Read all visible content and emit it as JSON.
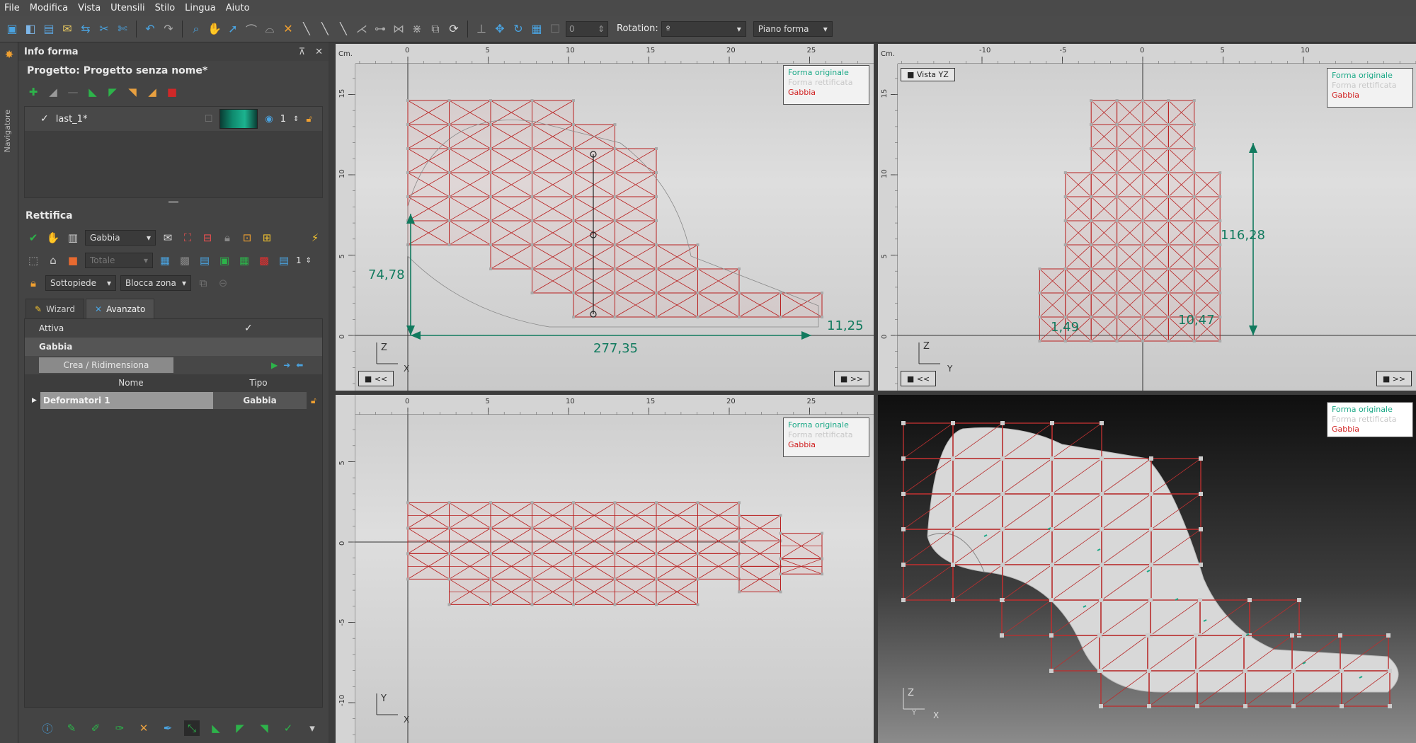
{
  "menu": [
    "File",
    "Modifica",
    "Vista",
    "Utensili",
    "Stilo",
    "Lingua",
    "Aiuto"
  ],
  "toolbar": {
    "spin_value": "0",
    "rotation_label": "Rotation:",
    "rotation_value": "º",
    "plane_value": "Piano forma"
  },
  "sidebar": {
    "navigator_label": "Navigatore",
    "info_title": "Info forma",
    "project_title": "Progetto: Progetto senza nome*",
    "shape": {
      "name": "last_1*",
      "count": "1"
    },
    "rettifica_title": "Rettifica",
    "mode_combo": "Gabbia",
    "total_combo": "Totale",
    "level_value": "1",
    "zone_combo": "Sottopiede",
    "lock_combo": "Blocca zona",
    "tabs": [
      "Wizard",
      "Avanzato"
    ],
    "props": {
      "attiva_label": "Attiva",
      "attiva_check": "✓",
      "group_label": "Gabbia",
      "crea_button": "Crea / Ridimensiona",
      "col_nome": "Nome",
      "col_tipo": "Tipo",
      "row_name": "Deformatori 1",
      "row_type": "Gabbia"
    }
  },
  "viewports": {
    "ruler_unit": "Cm.",
    "legend": {
      "original": "Forma originale",
      "rectified": "Forma rettificata",
      "cage": "Gabbia"
    },
    "side": {
      "xticks": [
        "0",
        "5",
        "10",
        "15",
        "20",
        "25"
      ],
      "yticks": [
        "15",
        "10",
        "5",
        "0"
      ],
      "dim_height": "74,78",
      "dim_length": "277,35",
      "dim_right": "11,25",
      "axis_v": "Z",
      "axis_h": "X",
      "btn_prev": "■ <<",
      "btn_next": "■ >>"
    },
    "front": {
      "label": "■ Vista YZ",
      "xticks": [
        "-10",
        "-5",
        "0",
        "5",
        "10"
      ],
      "yticks": [
        "15",
        "10",
        "5",
        "0"
      ],
      "dim_height": "116,28",
      "dim_left": "1,49",
      "dim_right": "10,47",
      "axis_v": "Z",
      "axis_h": "Y",
      "btn_prev": "■ <<",
      "btn_next": "■ >>"
    },
    "top": {
      "xticks": [
        "0",
        "5",
        "10",
        "15",
        "20",
        "25"
      ],
      "yticks": [
        "5",
        "0",
        "-5",
        "-10"
      ],
      "axis_v": "Y",
      "axis_h": "X"
    },
    "persp": {
      "axis_v": "Z",
      "axis_h": "X",
      "axis_d": "Y"
    }
  },
  "colors": {
    "cage": "#b82020",
    "dimension": "#117a5e",
    "accent": "#1aa886"
  }
}
